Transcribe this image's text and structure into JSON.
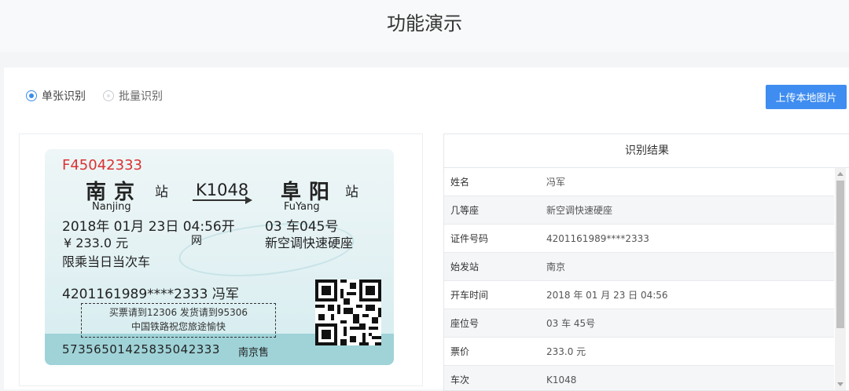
{
  "header": {
    "title": "功能演示"
  },
  "mode": {
    "single_label": "单张识别",
    "batch_label": "批量识别",
    "selected": "single"
  },
  "upload_label": "上传本地图片",
  "ticket": {
    "serial": "F45042333",
    "from": "南京",
    "station_suffix": "站",
    "train_no": "K1048",
    "to": "阜阳",
    "from_pinyin": "Nanjing",
    "to_pinyin": "FuYang",
    "date_line": "2018年 01月 23日  04:56开",
    "seat_line": "03 车045号",
    "price_line": "¥ 233.0 元",
    "net_label": "网",
    "seat_type": "新空调快速硬座",
    "limit_text": "限乘当日当次车",
    "id_name_line": "4201161989****2333  冯军",
    "note_line1": "买票请到12306 发货请到95306",
    "note_line2": "中国铁路祝您旅途愉快",
    "code": "57356501425835042333",
    "sold_at": "南京售"
  },
  "result": {
    "title": "识别结果",
    "rows": [
      {
        "key": "姓名",
        "value": "冯军"
      },
      {
        "key": "几等座",
        "value": "新空调快速硬座"
      },
      {
        "key": "证件号码",
        "value": "4201161989****2333"
      },
      {
        "key": "始发站",
        "value": "南京"
      },
      {
        "key": "开车时间",
        "value": "2018 年 01 月 23 日 04:56"
      },
      {
        "key": "座位号",
        "value": "03 车 45号"
      },
      {
        "key": "票价",
        "value": "233.0 元"
      },
      {
        "key": "车次",
        "value": "K1048"
      }
    ]
  },
  "colors": {
    "accent": "#3f8df0",
    "ticket_serial": "#d93232",
    "ticket_band": "#9fd3d8"
  }
}
